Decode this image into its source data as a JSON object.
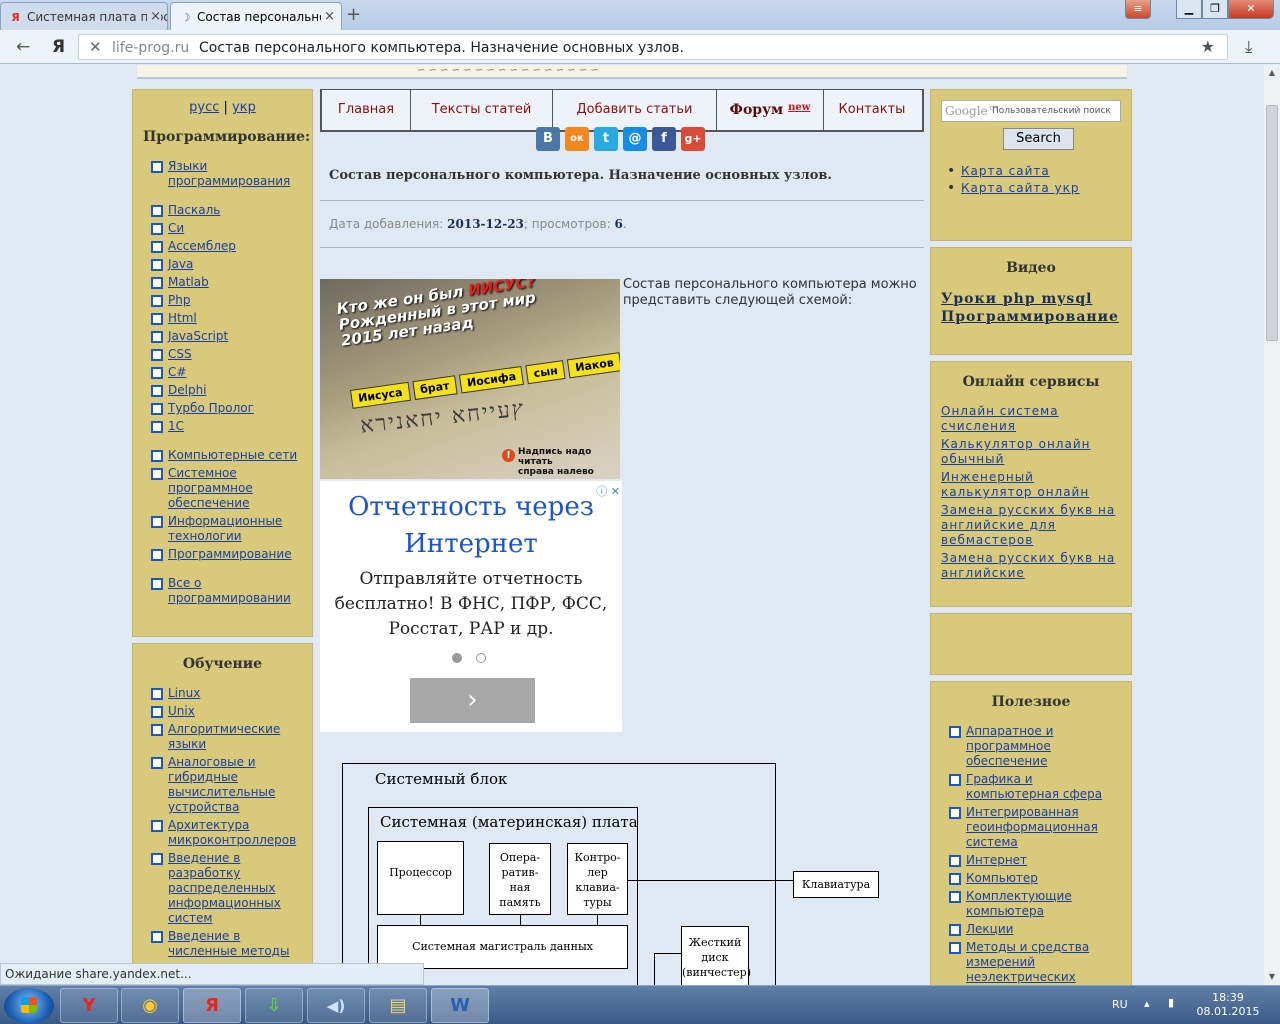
{
  "browser": {
    "tabs": [
      {
        "label": "Системная плата перс",
        "favicon": "Я",
        "active": false
      },
      {
        "label": "Состав персональног",
        "favicon": "☽",
        "active": true
      }
    ],
    "url_domain": "life-prog.ru",
    "page_title": "Состав персонального компьютера. Назначение основных узлов.",
    "status_text": "Ожидание share.yandex.net..."
  },
  "site": {
    "lang_links": [
      "русс",
      "укр"
    ],
    "lang_sep": "|",
    "nav": [
      {
        "label": "Главная"
      },
      {
        "label": "Тексты статей"
      },
      {
        "label": "Добавить статьи"
      },
      {
        "label": "Форум",
        "badge": "new"
      },
      {
        "label": "Контакты"
      }
    ],
    "share_icons": [
      {
        "name": "vk-icon",
        "glyph": "B",
        "color": "#4a76a8"
      },
      {
        "name": "odnoklassniki-icon",
        "glyph": "ок",
        "color": "#f2881d"
      },
      {
        "name": "twitter-icon",
        "glyph": "t",
        "color": "#2aa9e0"
      },
      {
        "name": "mail-ru-icon",
        "glyph": "@",
        "color": "#168de2"
      },
      {
        "name": "facebook-icon",
        "glyph": "f",
        "color": "#3b5998"
      },
      {
        "name": "google-plus-icon",
        "glyph": "g+",
        "color": "#d84b37"
      }
    ],
    "article": {
      "title": "Состав персонального компьютера. Назначение основных узлов.",
      "date_label": "Дата добавления:",
      "date": "2013-12-23",
      "views_label": "; просмотров:",
      "views": "6",
      "views_end": ".",
      "intro": "Состав персонального компьютера можно представить следующей схемой:"
    },
    "ad_image": {
      "line1": "Кто же он был",
      "line1_red": "ИИСУС?",
      "line2": "Рожденный в этот мир",
      "line3": "2015 лет назад",
      "chips": [
        "Иисуса",
        "брат",
        "Иосифа",
        "сын",
        "Иаков"
      ],
      "note_line1": "Надпись надо читать",
      "note_line2": "справа налево"
    },
    "ad_text": {
      "headline_line1": "Отчетность через",
      "headline_line2": "Интернет",
      "body_line1": "Отправляйте отчетность",
      "body_line2": "бесплатно! В ФНС, ПФР, ФСС,",
      "body_line3": "Росстат, РАР и др.",
      "go_glyph": "›"
    },
    "diagram": {
      "outer": "Системный блок",
      "board": "Системная (материнская) плата",
      "cpu": "Процессор",
      "ram": [
        "Опера-",
        "ратив-",
        "ная",
        "память"
      ],
      "kbc": [
        "Контро-",
        "лер",
        "клавиа-",
        "туры"
      ],
      "keyboard": "Клавиатура",
      "bus": "Системная магистраль данных",
      "hdd": [
        "Жесткий",
        "диск",
        "(винчестер)"
      ]
    },
    "left_sidebar": {
      "programming_title": "Программирование:",
      "programming_links": [
        "Языки программирования",
        "Паскаль",
        "Си",
        "Ассемблер",
        "Java",
        "Matlab",
        "Php",
        "Html",
        "JavaScript",
        "CSS",
        "C#",
        "Delphi",
        "Турбо Пролог",
        "1С",
        "Компьютерные сети",
        "Системное программное обеспечение",
        "Информационные технологии",
        "Программирование",
        "Все о программировании"
      ],
      "learning_title": "Обучение",
      "learning_links": [
        "Linux",
        "Unix",
        "Алгоритмические языки",
        "Аналоговые и гибридные вычислительные устройства",
        "Архитектура микроконтроллеров",
        "Введение в разработку распределенных информационных систем",
        "Введение в численные методы"
      ]
    },
    "right_sidebar": {
      "search_placeholder": "Пользовательский поиск",
      "search_brand": "Google™",
      "search_button": "Search",
      "sitemap_links": [
        "Карта сайта",
        "Карта сайта укр"
      ],
      "video_title": "Видео",
      "video_links": [
        "Уроки php mysql",
        "Программирование"
      ],
      "services_title": "Онлайн сервисы",
      "services_links": [
        "Онлайн система счисления",
        "Калькулятор онлайн обычный",
        "Инженерный калькулятор онлайн",
        "Замена русских букв на английские для вебмастеров",
        "Замена русских букв на английские"
      ],
      "useful_title": "Полезное",
      "useful_links": [
        "Аппаратное и программное обеспечение",
        "Графика и компьютерная сфера",
        "Интегрированная геоинформационная система",
        "Интернет",
        "Компьютер",
        "Комплектующие компьютера",
        "Лекции",
        "Методы и средства измерений неэлектрических"
      ]
    }
  },
  "taskbar": {
    "items": [
      {
        "name": "yandex-icon",
        "glyph": "Y",
        "color": "#e8261b"
      },
      {
        "name": "chrome-icon",
        "glyph": "◉",
        "color": "#ffcb2b"
      },
      {
        "name": "yandex-browser-icon",
        "glyph": "Я",
        "color": "#e8261b"
      },
      {
        "name": "download-icon",
        "glyph": "⇩",
        "color": "#5fd04a"
      },
      {
        "name": "speaker-icon",
        "glyph": "◀)",
        "color": "#cfe4ff"
      },
      {
        "name": "folder-icon",
        "glyph": "▤",
        "color": "#f2d36b"
      },
      {
        "name": "word-icon",
        "glyph": "W",
        "color": "#2b5fb3"
      }
    ],
    "lang": "RU",
    "time": "18:39",
    "date": "08.01.2015"
  }
}
